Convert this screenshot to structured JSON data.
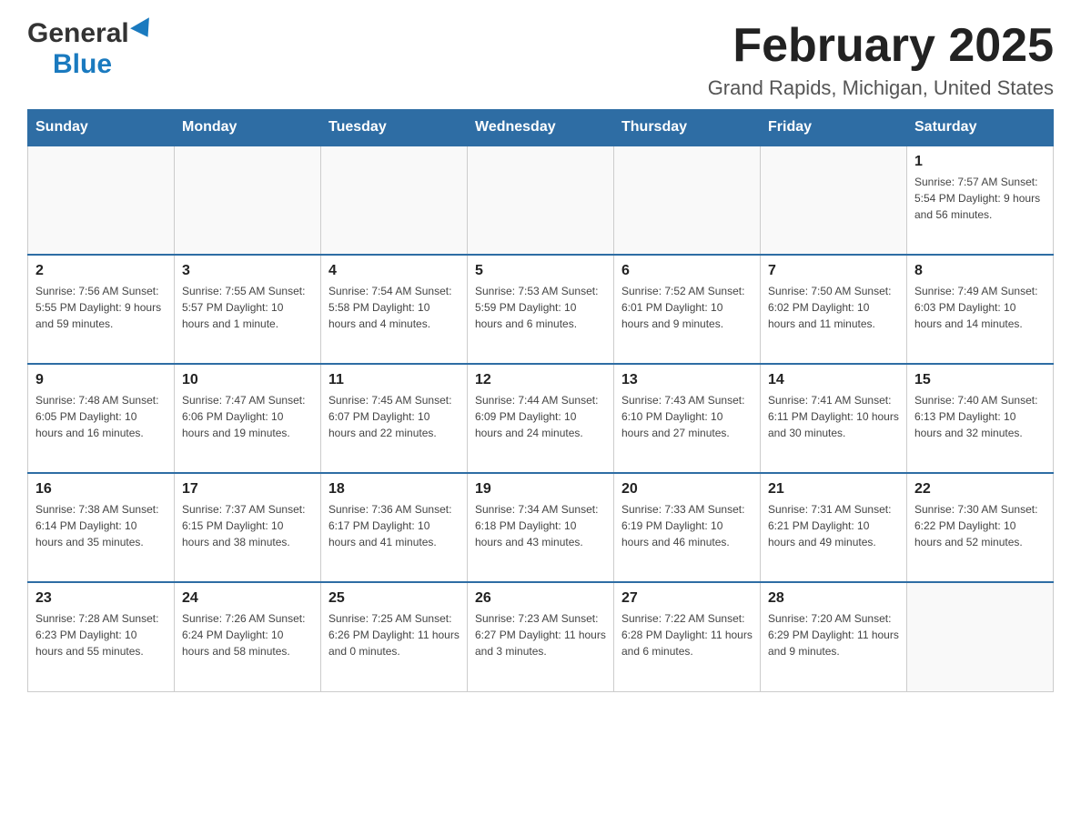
{
  "header": {
    "logo_general": "General",
    "logo_blue": "Blue",
    "main_title": "February 2025",
    "subtitle": "Grand Rapids, Michigan, United States"
  },
  "weekdays": [
    "Sunday",
    "Monday",
    "Tuesday",
    "Wednesday",
    "Thursday",
    "Friday",
    "Saturday"
  ],
  "weeks": [
    [
      {
        "day": "",
        "info": ""
      },
      {
        "day": "",
        "info": ""
      },
      {
        "day": "",
        "info": ""
      },
      {
        "day": "",
        "info": ""
      },
      {
        "day": "",
        "info": ""
      },
      {
        "day": "",
        "info": ""
      },
      {
        "day": "1",
        "info": "Sunrise: 7:57 AM\nSunset: 5:54 PM\nDaylight: 9 hours and 56 minutes."
      }
    ],
    [
      {
        "day": "2",
        "info": "Sunrise: 7:56 AM\nSunset: 5:55 PM\nDaylight: 9 hours and 59 minutes."
      },
      {
        "day": "3",
        "info": "Sunrise: 7:55 AM\nSunset: 5:57 PM\nDaylight: 10 hours and 1 minute."
      },
      {
        "day": "4",
        "info": "Sunrise: 7:54 AM\nSunset: 5:58 PM\nDaylight: 10 hours and 4 minutes."
      },
      {
        "day": "5",
        "info": "Sunrise: 7:53 AM\nSunset: 5:59 PM\nDaylight: 10 hours and 6 minutes."
      },
      {
        "day": "6",
        "info": "Sunrise: 7:52 AM\nSunset: 6:01 PM\nDaylight: 10 hours and 9 minutes."
      },
      {
        "day": "7",
        "info": "Sunrise: 7:50 AM\nSunset: 6:02 PM\nDaylight: 10 hours and 11 minutes."
      },
      {
        "day": "8",
        "info": "Sunrise: 7:49 AM\nSunset: 6:03 PM\nDaylight: 10 hours and 14 minutes."
      }
    ],
    [
      {
        "day": "9",
        "info": "Sunrise: 7:48 AM\nSunset: 6:05 PM\nDaylight: 10 hours and 16 minutes."
      },
      {
        "day": "10",
        "info": "Sunrise: 7:47 AM\nSunset: 6:06 PM\nDaylight: 10 hours and 19 minutes."
      },
      {
        "day": "11",
        "info": "Sunrise: 7:45 AM\nSunset: 6:07 PM\nDaylight: 10 hours and 22 minutes."
      },
      {
        "day": "12",
        "info": "Sunrise: 7:44 AM\nSunset: 6:09 PM\nDaylight: 10 hours and 24 minutes."
      },
      {
        "day": "13",
        "info": "Sunrise: 7:43 AM\nSunset: 6:10 PM\nDaylight: 10 hours and 27 minutes."
      },
      {
        "day": "14",
        "info": "Sunrise: 7:41 AM\nSunset: 6:11 PM\nDaylight: 10 hours and 30 minutes."
      },
      {
        "day": "15",
        "info": "Sunrise: 7:40 AM\nSunset: 6:13 PM\nDaylight: 10 hours and 32 minutes."
      }
    ],
    [
      {
        "day": "16",
        "info": "Sunrise: 7:38 AM\nSunset: 6:14 PM\nDaylight: 10 hours and 35 minutes."
      },
      {
        "day": "17",
        "info": "Sunrise: 7:37 AM\nSunset: 6:15 PM\nDaylight: 10 hours and 38 minutes."
      },
      {
        "day": "18",
        "info": "Sunrise: 7:36 AM\nSunset: 6:17 PM\nDaylight: 10 hours and 41 minutes."
      },
      {
        "day": "19",
        "info": "Sunrise: 7:34 AM\nSunset: 6:18 PM\nDaylight: 10 hours and 43 minutes."
      },
      {
        "day": "20",
        "info": "Sunrise: 7:33 AM\nSunset: 6:19 PM\nDaylight: 10 hours and 46 minutes."
      },
      {
        "day": "21",
        "info": "Sunrise: 7:31 AM\nSunset: 6:21 PM\nDaylight: 10 hours and 49 minutes."
      },
      {
        "day": "22",
        "info": "Sunrise: 7:30 AM\nSunset: 6:22 PM\nDaylight: 10 hours and 52 minutes."
      }
    ],
    [
      {
        "day": "23",
        "info": "Sunrise: 7:28 AM\nSunset: 6:23 PM\nDaylight: 10 hours and 55 minutes."
      },
      {
        "day": "24",
        "info": "Sunrise: 7:26 AM\nSunset: 6:24 PM\nDaylight: 10 hours and 58 minutes."
      },
      {
        "day": "25",
        "info": "Sunrise: 7:25 AM\nSunset: 6:26 PM\nDaylight: 11 hours and 0 minutes."
      },
      {
        "day": "26",
        "info": "Sunrise: 7:23 AM\nSunset: 6:27 PM\nDaylight: 11 hours and 3 minutes."
      },
      {
        "day": "27",
        "info": "Sunrise: 7:22 AM\nSunset: 6:28 PM\nDaylight: 11 hours and 6 minutes."
      },
      {
        "day": "28",
        "info": "Sunrise: 7:20 AM\nSunset: 6:29 PM\nDaylight: 11 hours and 9 minutes."
      },
      {
        "day": "",
        "info": ""
      }
    ]
  ]
}
